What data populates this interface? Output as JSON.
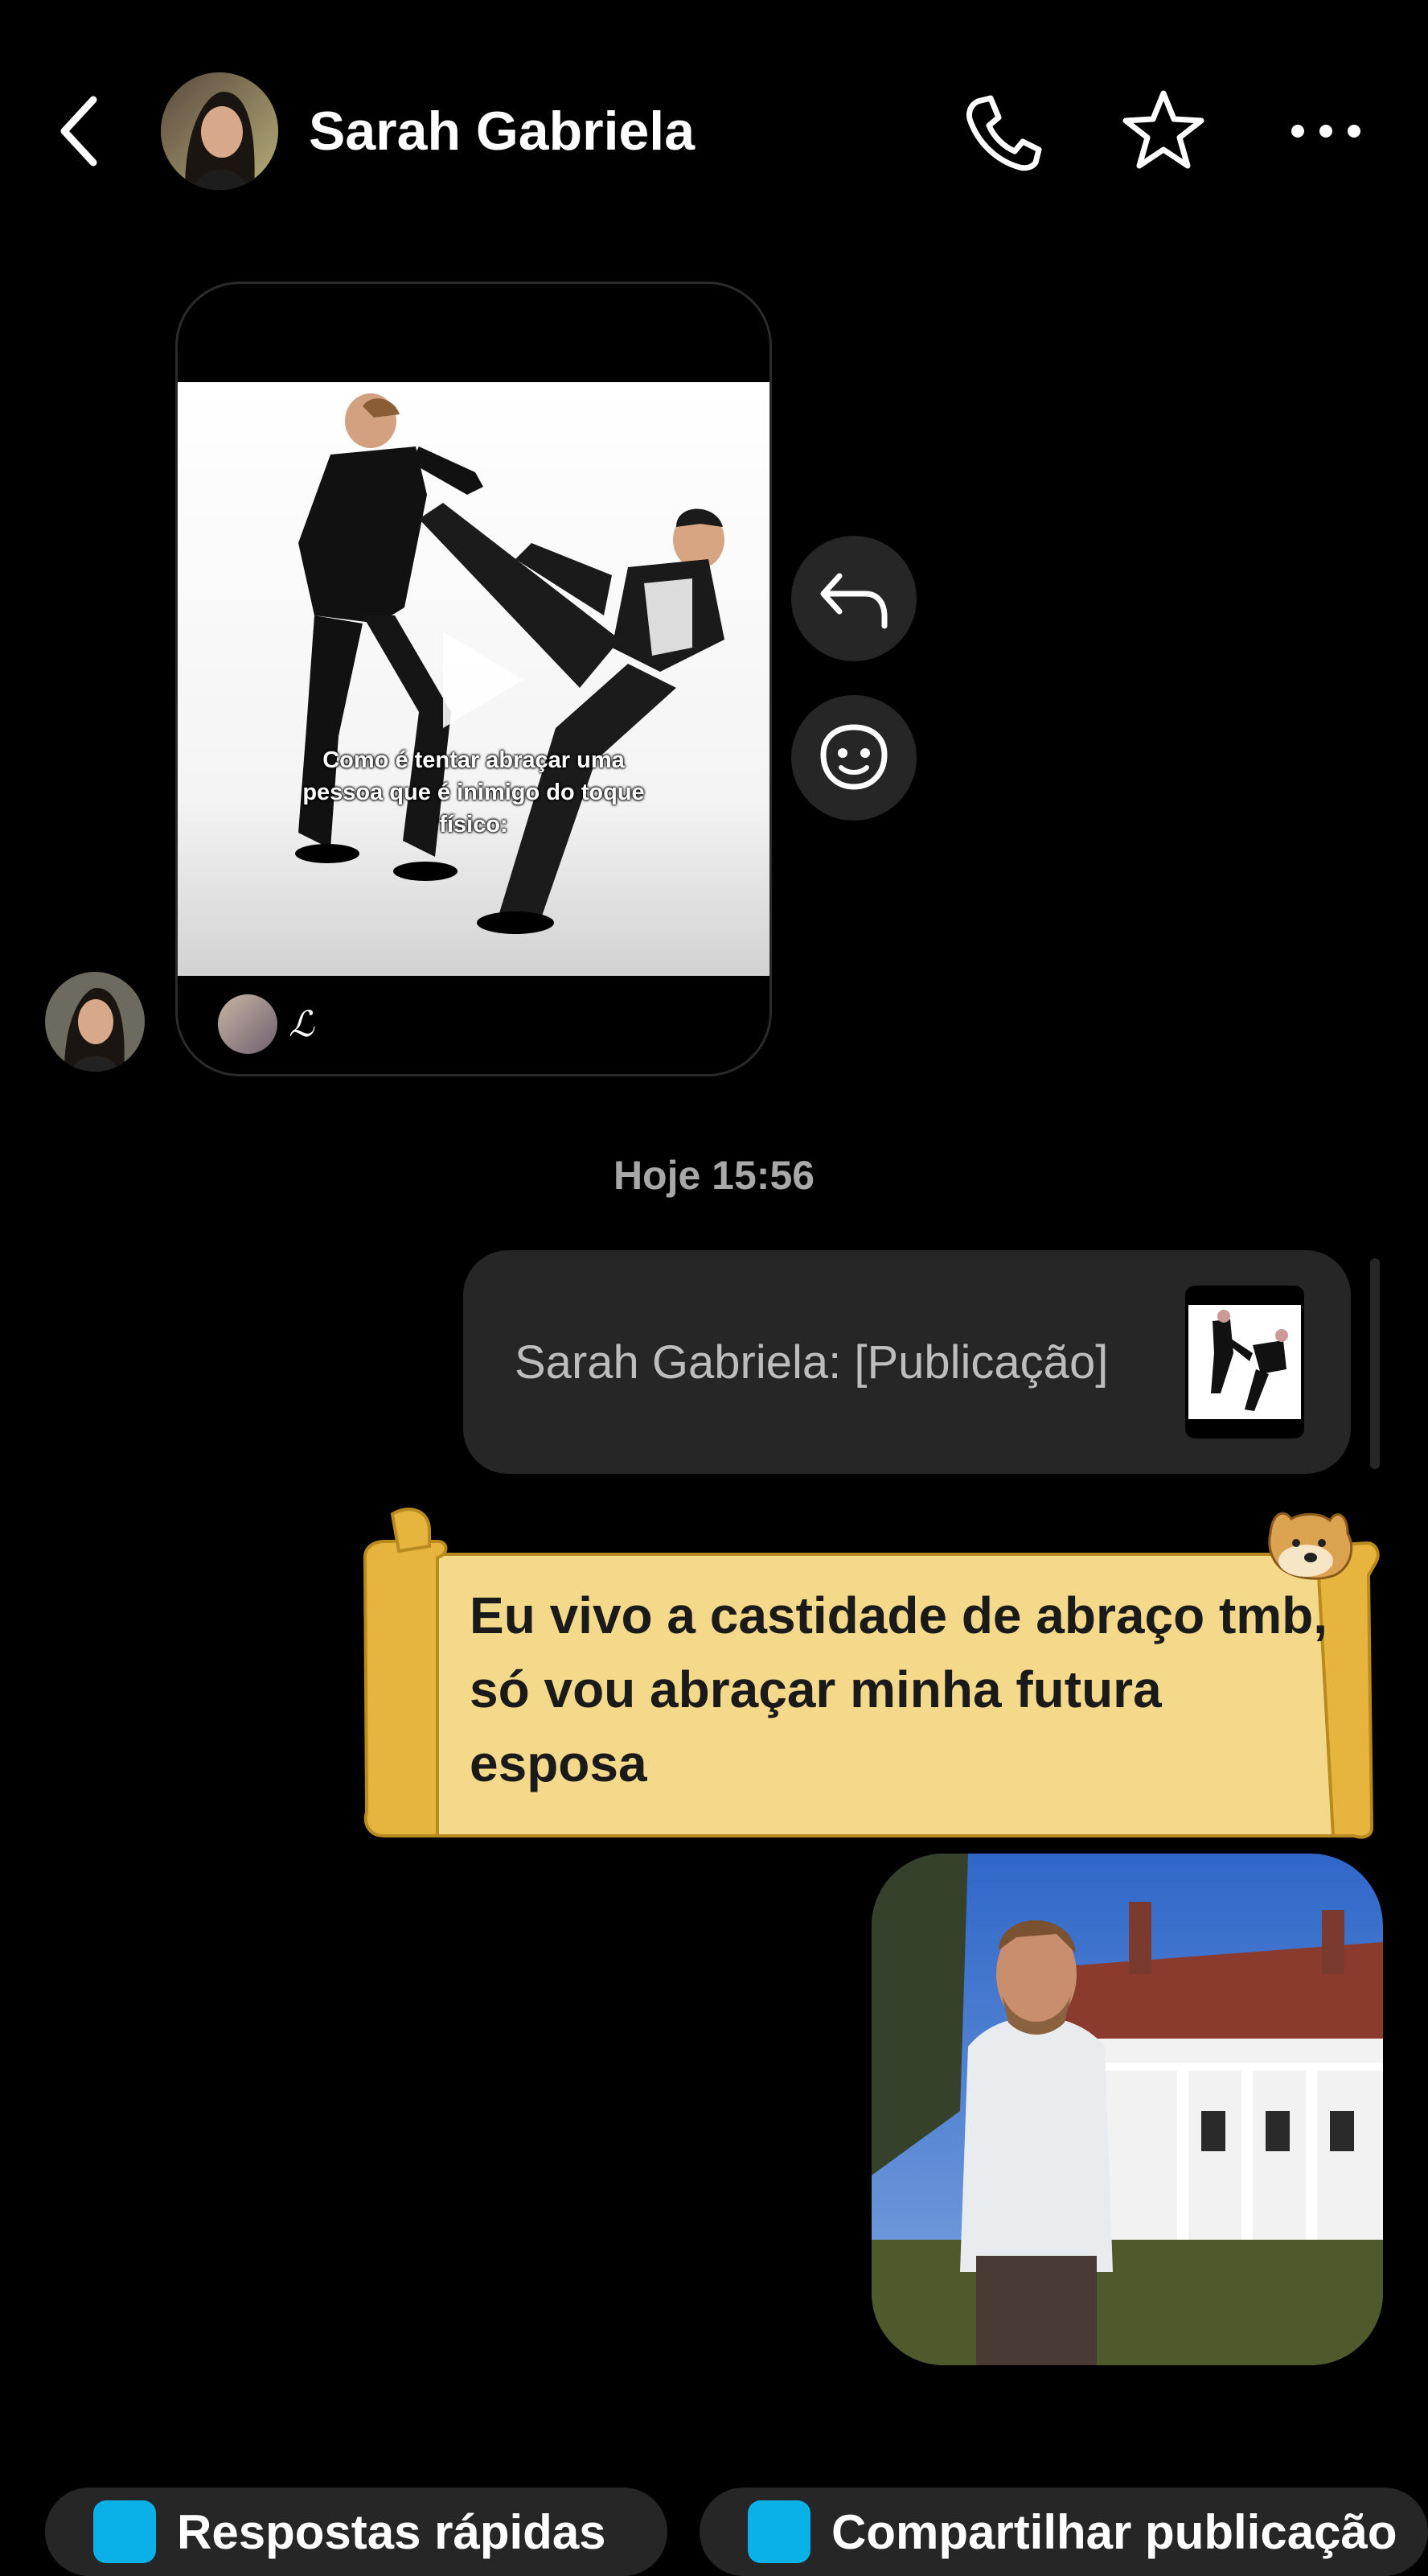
{
  "header": {
    "contact_name": "Sarah Gabriela",
    "icons": [
      "back-arrow-icon",
      "phone-icon",
      "star-icon",
      "more-icon"
    ]
  },
  "shared_post": {
    "caption": "Como é tentar abraçar uma pessoa que é inimigo do toque físico:",
    "author_glyph": "ℒ"
  },
  "timestamp": "Hoje 15:56",
  "reply_preview": {
    "text": "Sarah Gabriela: [Publicação]"
  },
  "message": {
    "text": "Eu vivo a castidade de abraço tmb, só vou abraçar minha futura esposa"
  },
  "quick_actions": [
    {
      "label": "Respostas rápidas",
      "icon": "lightning-icon"
    },
    {
      "label": "Compartilhar publicação",
      "icon": "play-icon"
    }
  ],
  "colors": {
    "background": "#000000",
    "bubble_dark": "#262626",
    "scroll_paper": "#f5d98a",
    "scroll_edge": "#e7b53e",
    "accent_blue": "#0ab0e8"
  }
}
